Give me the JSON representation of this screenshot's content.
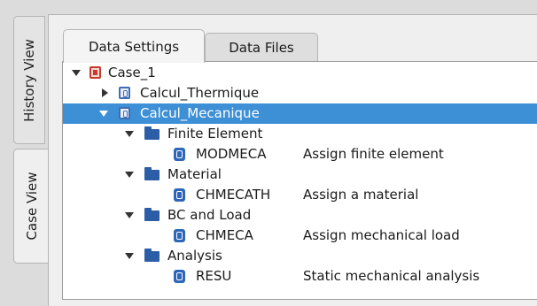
{
  "side_tabs": [
    {
      "label": "History View",
      "active": false
    },
    {
      "label": "Case View",
      "active": true
    }
  ],
  "top_tabs": [
    {
      "label": "Data Settings",
      "active": true
    },
    {
      "label": "Data Files",
      "active": false
    }
  ],
  "tree": {
    "rows": [
      {
        "label": "Case_1",
        "expanded": true,
        "icon": "case-icon"
      },
      {
        "label": "Calcul_Thermique",
        "expanded": false,
        "icon": "calculation-icon"
      },
      {
        "label": "Calcul_Mecanique",
        "expanded": true,
        "selected": true,
        "icon": "calculation-icon"
      },
      {
        "label": "Finite Element",
        "expanded": true,
        "icon": "folder-icon"
      },
      {
        "label": "MODMECA",
        "description": "Assign finite element",
        "icon": "command-icon"
      },
      {
        "label": "Material",
        "expanded": true,
        "icon": "folder-icon"
      },
      {
        "label": "CHMECATH",
        "description": "Assign a material",
        "icon": "command-icon"
      },
      {
        "label": "BC and Load",
        "expanded": true,
        "icon": "folder-icon"
      },
      {
        "label": "CHMECA",
        "description": "Assign mechanical load",
        "icon": "command-icon"
      },
      {
        "label": "Analysis",
        "expanded": true,
        "icon": "folder-icon"
      },
      {
        "label": "RESU",
        "description": "Static mechanical analysis",
        "icon": "command-icon"
      }
    ]
  },
  "colors": {
    "selection": "#3d8fd6",
    "case_icon": "#c73a2d",
    "folder_icon": "#2c5ea8"
  }
}
